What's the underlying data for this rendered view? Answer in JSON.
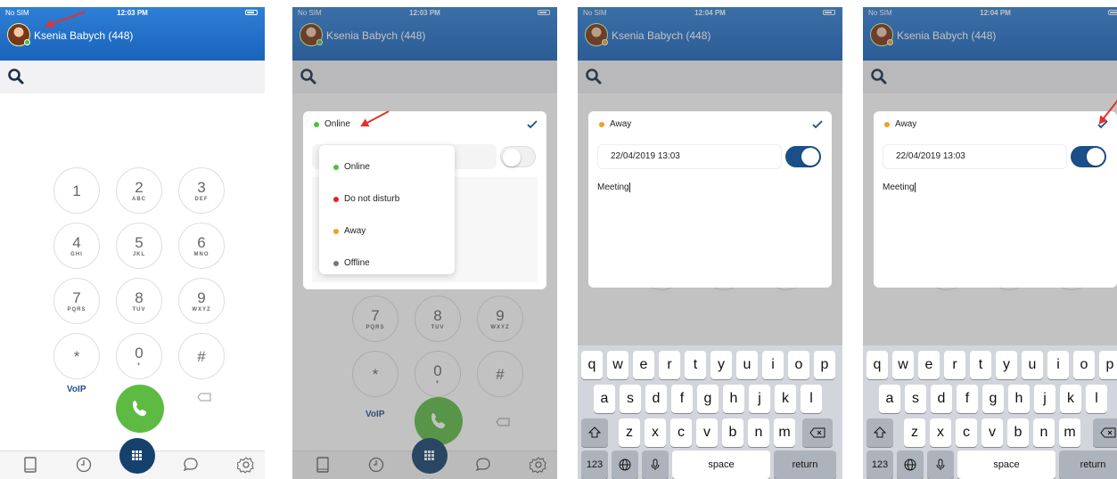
{
  "status_bar": {
    "carrier": "No SIM",
    "times": [
      "12:03 PM",
      "12:03 PM",
      "12:04 PM",
      "12:04 PM"
    ]
  },
  "user": {
    "name": "Ksenia Babych (448)"
  },
  "dialpad": {
    "keys": [
      {
        "digit": "1",
        "letters": ""
      },
      {
        "digit": "2",
        "letters": "ABC"
      },
      {
        "digit": "3",
        "letters": "DEF"
      },
      {
        "digit": "4",
        "letters": "GHI"
      },
      {
        "digit": "5",
        "letters": "JKL"
      },
      {
        "digit": "6",
        "letters": "MNO"
      },
      {
        "digit": "7",
        "letters": "PQRS"
      },
      {
        "digit": "8",
        "letters": "TUV"
      },
      {
        "digit": "9",
        "letters": "WXYZ"
      },
      {
        "digit": "*",
        "letters": ""
      },
      {
        "digit": "0",
        "letters": "+"
      },
      {
        "digit": "#",
        "letters": ""
      }
    ],
    "voip_label": "VoIP"
  },
  "presence_menu": {
    "current": "Online",
    "options": [
      {
        "label": "Online",
        "color": "#4cc23a"
      },
      {
        "label": "Do not disturb",
        "color": "#e02424"
      },
      {
        "label": "Away",
        "color": "#f0a020"
      },
      {
        "label": "Offline",
        "color": "#777777"
      }
    ]
  },
  "away_form": {
    "status": "Away",
    "datetime": "22/04/2019 13:03",
    "note": "Meeting"
  },
  "keyboard": {
    "row1": [
      "q",
      "w",
      "e",
      "r",
      "t",
      "y",
      "u",
      "i",
      "o",
      "p"
    ],
    "row2": [
      "a",
      "s",
      "d",
      "f",
      "g",
      "h",
      "j",
      "k",
      "l"
    ],
    "row3": [
      "z",
      "x",
      "c",
      "v",
      "b",
      "n",
      "m"
    ],
    "numbers_label": "123",
    "space_label": "space",
    "return_label": "return"
  },
  "colors": {
    "header": "#1f6cc4",
    "online": "#4cc23a",
    "away": "#f0a020",
    "call": "#5dbb44",
    "fab": "#15416d",
    "toggle_on": "#1a4f8a"
  },
  "icons": [
    "search-icon",
    "phone-icon",
    "contacts-icon",
    "history-icon",
    "dialpad-icon",
    "chat-icon",
    "settings-icon",
    "checkmark-icon",
    "shift-icon",
    "backspace-icon",
    "globe-icon",
    "microphone-icon"
  ]
}
